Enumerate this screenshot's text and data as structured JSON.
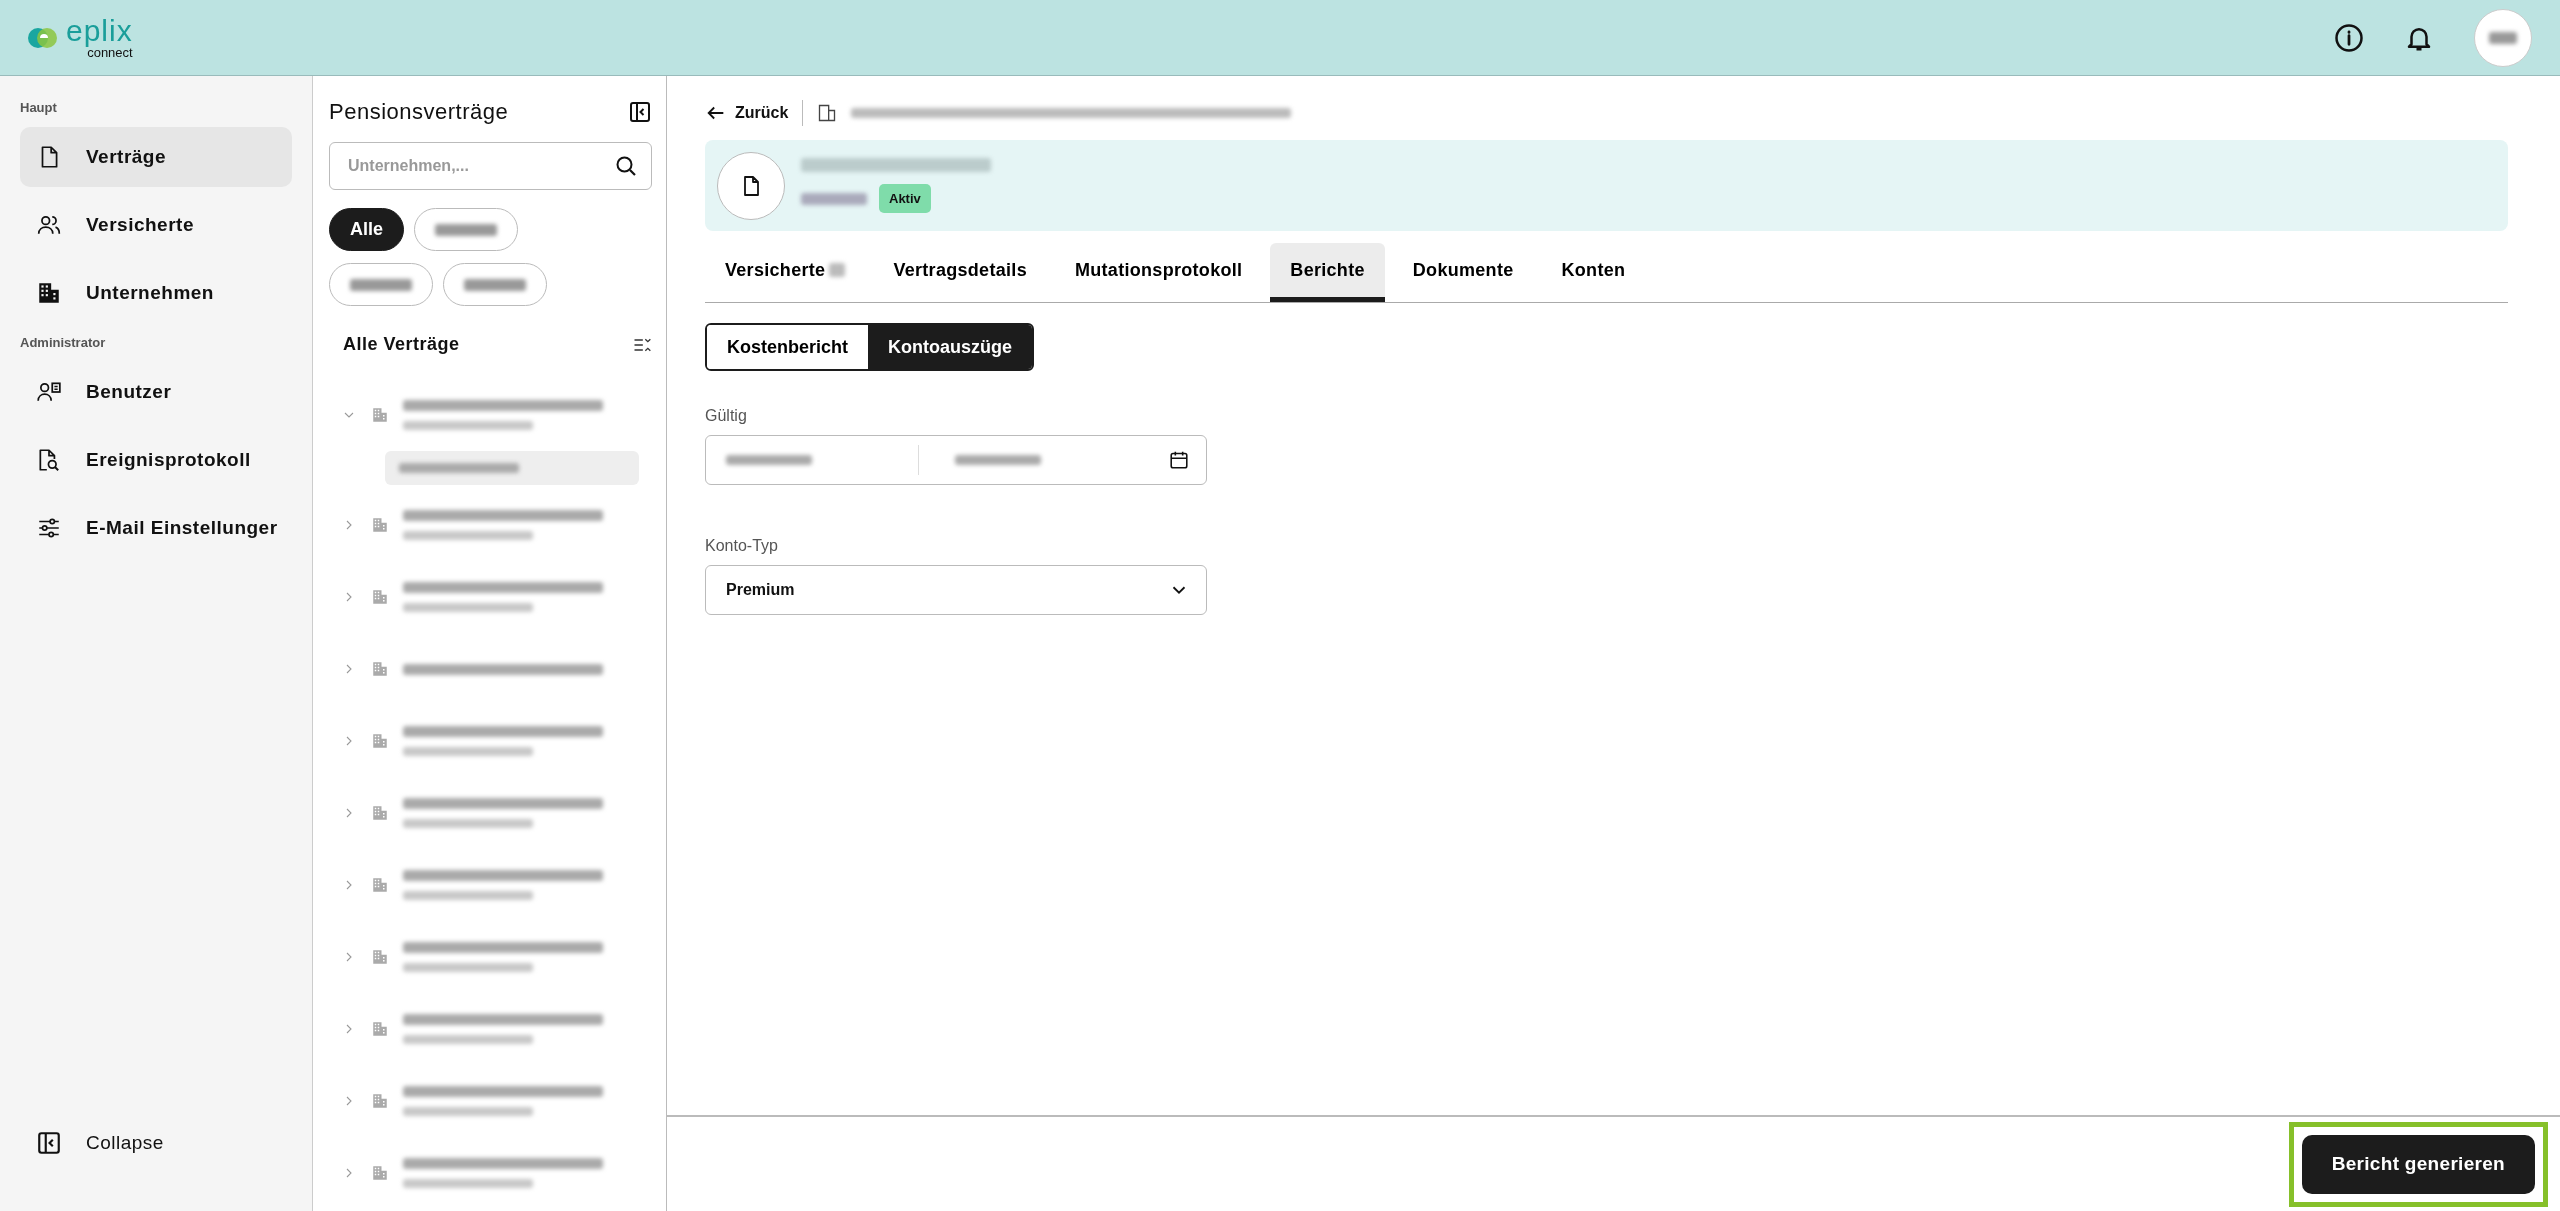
{
  "header": {
    "logo": {
      "name": "eplix",
      "tagline": "connect"
    }
  },
  "sidebar": {
    "sections": [
      {
        "title": "Haupt",
        "items": [
          {
            "label": "Verträge",
            "selected": true
          },
          {
            "label": "Versicherte",
            "selected": false
          },
          {
            "label": "Unternehmen",
            "selected": false
          }
        ]
      },
      {
        "title": "Administrator",
        "items": [
          {
            "label": "Benutzer",
            "selected": false
          },
          {
            "label": "Ereignisprotokoll",
            "selected": false
          },
          {
            "label": "E-Mail Einstellunger",
            "selected": false
          }
        ]
      }
    ],
    "collapse": {
      "label": "Collapse"
    }
  },
  "contracts_panel": {
    "title": "Pensionsverträge",
    "search": {
      "placeholder": "Unternehmen,..."
    },
    "filters": [
      {
        "kind": "text",
        "label": "Alle",
        "selected": true
      },
      {
        "kind": "redacted",
        "selected": false
      },
      {
        "kind": "redacted",
        "selected": false
      },
      {
        "kind": "redacted",
        "selected": false
      }
    ],
    "list_title": "Alle Verträge",
    "items": [
      {
        "kind": "two-line",
        "expanded": true,
        "children": [
          {
            "kind": "redacted"
          }
        ]
      },
      {
        "kind": "two-line",
        "expanded": false
      },
      {
        "kind": "two-line",
        "expanded": false
      },
      {
        "kind": "one-line",
        "expanded": false
      },
      {
        "kind": "two-line",
        "expanded": false
      },
      {
        "kind": "two-line",
        "expanded": false
      },
      {
        "kind": "two-line",
        "expanded": false
      },
      {
        "kind": "two-line",
        "expanded": false
      },
      {
        "kind": "two-line",
        "expanded": false
      },
      {
        "kind": "two-line",
        "expanded": false
      },
      {
        "kind": "two-line",
        "expanded": false
      }
    ]
  },
  "main": {
    "back": {
      "label": "Zurück"
    },
    "contract": {
      "status": "Aktiv"
    },
    "tabs": [
      {
        "label": "Versicherte",
        "count_redacted": true,
        "selected": false
      },
      {
        "label": "Vertragsdetails",
        "selected": false
      },
      {
        "label": "Mutationsprotokoll",
        "selected": false
      },
      {
        "label": "Berichte",
        "selected": true
      },
      {
        "label": "Dokumente",
        "selected": false
      },
      {
        "label": "Konten",
        "selected": false
      }
    ],
    "report_types": [
      {
        "label": "Kostenbericht",
        "selected": false
      },
      {
        "label": "Kontoauszüge",
        "selected": true
      }
    ],
    "valid": {
      "label": "Gültig"
    },
    "account_type": {
      "label": "Konto-Typ",
      "value": "Premium"
    },
    "generate_button": {
      "label": "Bericht generieren",
      "highlighted": true
    }
  }
}
